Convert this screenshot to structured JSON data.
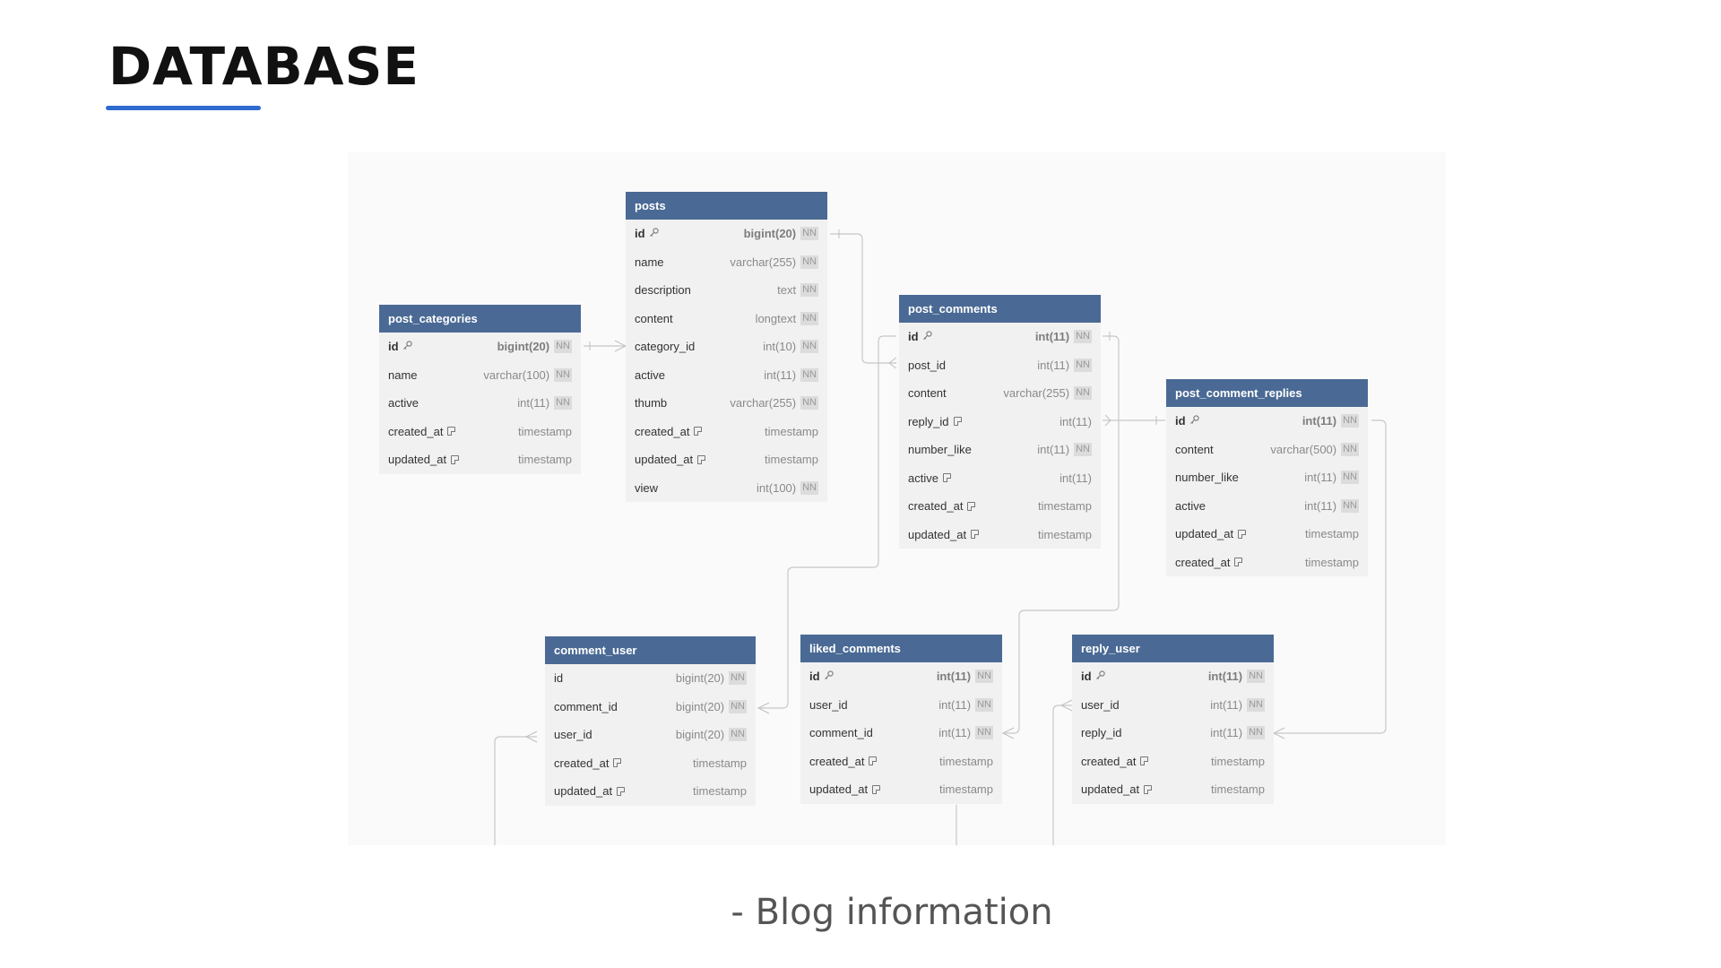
{
  "title": "DATABASE",
  "caption": "- Blog information",
  "colors": {
    "header": "#4a6a95",
    "accent": "#2f6ad0",
    "table_body": "#f1f1f1"
  },
  "icons": {
    "primary_key": "key-icon",
    "note": "note-icon"
  },
  "nn_label": "NN",
  "tables": {
    "posts": {
      "name": "posts",
      "fields": [
        {
          "name": "id",
          "type": "bigint(20)",
          "nn": true,
          "pk": true,
          "note": false
        },
        {
          "name": "name",
          "type": "varchar(255)",
          "nn": true,
          "pk": false,
          "note": false
        },
        {
          "name": "description",
          "type": "text",
          "nn": true,
          "pk": false,
          "note": false
        },
        {
          "name": "content",
          "type": "longtext",
          "nn": true,
          "pk": false,
          "note": false
        },
        {
          "name": "category_id",
          "type": "int(10)",
          "nn": true,
          "pk": false,
          "note": false
        },
        {
          "name": "active",
          "type": "int(11)",
          "nn": true,
          "pk": false,
          "note": false
        },
        {
          "name": "thumb",
          "type": "varchar(255)",
          "nn": true,
          "pk": false,
          "note": false
        },
        {
          "name": "created_at",
          "type": "timestamp",
          "nn": false,
          "pk": false,
          "note": true
        },
        {
          "name": "updated_at",
          "type": "timestamp",
          "nn": false,
          "pk": false,
          "note": true
        },
        {
          "name": "view",
          "type": "int(100)",
          "nn": true,
          "pk": false,
          "note": false
        }
      ]
    },
    "post_categories": {
      "name": "post_categories",
      "fields": [
        {
          "name": "id",
          "type": "bigint(20)",
          "nn": true,
          "pk": true,
          "note": false
        },
        {
          "name": "name",
          "type": "varchar(100)",
          "nn": true,
          "pk": false,
          "note": false
        },
        {
          "name": "active",
          "type": "int(11)",
          "nn": true,
          "pk": false,
          "note": false
        },
        {
          "name": "created_at",
          "type": "timestamp",
          "nn": false,
          "pk": false,
          "note": true
        },
        {
          "name": "updated_at",
          "type": "timestamp",
          "nn": false,
          "pk": false,
          "note": true
        }
      ]
    },
    "post_comments": {
      "name": "post_comments",
      "fields": [
        {
          "name": "id",
          "type": "int(11)",
          "nn": true,
          "pk": true,
          "note": false
        },
        {
          "name": "post_id",
          "type": "int(11)",
          "nn": true,
          "pk": false,
          "note": false
        },
        {
          "name": "content",
          "type": "varchar(255)",
          "nn": true,
          "pk": false,
          "note": false
        },
        {
          "name": "reply_id",
          "type": "int(11)",
          "nn": false,
          "pk": false,
          "note": true
        },
        {
          "name": "number_like",
          "type": "int(11)",
          "nn": true,
          "pk": false,
          "note": false
        },
        {
          "name": "active",
          "type": "int(11)",
          "nn": false,
          "pk": false,
          "note": true
        },
        {
          "name": "created_at",
          "type": "timestamp",
          "nn": false,
          "pk": false,
          "note": true
        },
        {
          "name": "updated_at",
          "type": "timestamp",
          "nn": false,
          "pk": false,
          "note": true
        }
      ]
    },
    "post_comment_replies": {
      "name": "post_comment_replies",
      "fields": [
        {
          "name": "id",
          "type": "int(11)",
          "nn": true,
          "pk": true,
          "note": false
        },
        {
          "name": "content",
          "type": "varchar(500)",
          "nn": true,
          "pk": false,
          "note": false
        },
        {
          "name": "number_like",
          "type": "int(11)",
          "nn": true,
          "pk": false,
          "note": false
        },
        {
          "name": "active",
          "type": "int(11)",
          "nn": true,
          "pk": false,
          "note": false
        },
        {
          "name": "updated_at",
          "type": "timestamp",
          "nn": false,
          "pk": false,
          "note": true
        },
        {
          "name": "created_at",
          "type": "timestamp",
          "nn": false,
          "pk": false,
          "note": true
        }
      ]
    },
    "comment_user": {
      "name": "comment_user",
      "fields": [
        {
          "name": "id",
          "type": "bigint(20)",
          "nn": true,
          "pk": false,
          "note": false
        },
        {
          "name": "comment_id",
          "type": "bigint(20)",
          "nn": true,
          "pk": false,
          "note": false
        },
        {
          "name": "user_id",
          "type": "bigint(20)",
          "nn": true,
          "pk": false,
          "note": false
        },
        {
          "name": "created_at",
          "type": "timestamp",
          "nn": false,
          "pk": false,
          "note": true
        },
        {
          "name": "updated_at",
          "type": "timestamp",
          "nn": false,
          "pk": false,
          "note": true
        }
      ]
    },
    "liked_comments": {
      "name": "liked_comments",
      "fields": [
        {
          "name": "id",
          "type": "int(11)",
          "nn": true,
          "pk": true,
          "note": false
        },
        {
          "name": "user_id",
          "type": "int(11)",
          "nn": true,
          "pk": false,
          "note": false
        },
        {
          "name": "comment_id",
          "type": "int(11)",
          "nn": true,
          "pk": false,
          "note": false
        },
        {
          "name": "created_at",
          "type": "timestamp",
          "nn": false,
          "pk": false,
          "note": true
        },
        {
          "name": "updated_at",
          "type": "timestamp",
          "nn": false,
          "pk": false,
          "note": true
        }
      ]
    },
    "reply_user": {
      "name": "reply_user",
      "fields": [
        {
          "name": "id",
          "type": "int(11)",
          "nn": true,
          "pk": true,
          "note": false
        },
        {
          "name": "user_id",
          "type": "int(11)",
          "nn": true,
          "pk": false,
          "note": false
        },
        {
          "name": "reply_id",
          "type": "int(11)",
          "nn": true,
          "pk": false,
          "note": false
        },
        {
          "name": "created_at",
          "type": "timestamp",
          "nn": false,
          "pk": false,
          "note": true
        },
        {
          "name": "updated_at",
          "type": "timestamp",
          "nn": false,
          "pk": false,
          "note": true
        }
      ]
    }
  }
}
